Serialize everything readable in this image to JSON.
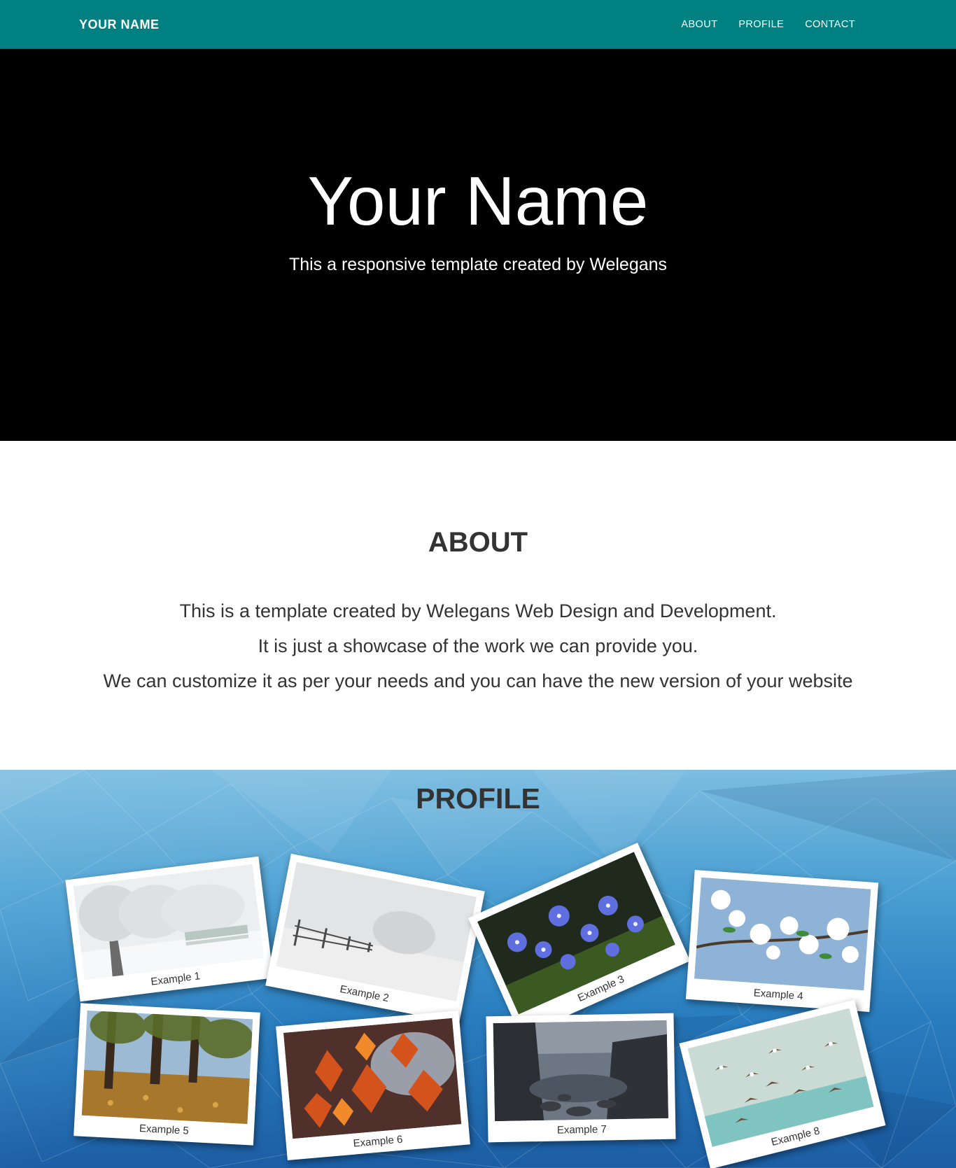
{
  "navbar": {
    "brand": "YOUR NAME",
    "links": [
      "ABOUT",
      "PROFILE",
      "CONTACT"
    ]
  },
  "hero": {
    "title": "Your Name",
    "subtitle": "This a responsive template created by Welegans"
  },
  "about": {
    "heading": "ABOUT",
    "lines": [
      "This is a template created by Welegans Web Design and Development.",
      "It is just a showcase of the work we can provide you.",
      "We can customize it as per your needs and you can have the new version of your website"
    ]
  },
  "profile": {
    "heading": "PROFILE",
    "photos": [
      {
        "caption": "Example 1",
        "subject": "snowy-trees"
      },
      {
        "caption": "Example 2",
        "subject": "foggy-fence"
      },
      {
        "caption": "Example 3",
        "subject": "blue-flowers"
      },
      {
        "caption": "Example 4",
        "subject": "white-blossoms"
      },
      {
        "caption": "Example 5",
        "subject": "autumn-park"
      },
      {
        "caption": "Example 6",
        "subject": "red-leaves"
      },
      {
        "caption": "Example 7",
        "subject": "rocky-shore"
      },
      {
        "caption": "Example 8",
        "subject": "flying-birds"
      }
    ]
  },
  "colors": {
    "navbar": "#008080",
    "hero": "#000000",
    "text": "#333333",
    "profile_bg": "#2a7fc0"
  }
}
